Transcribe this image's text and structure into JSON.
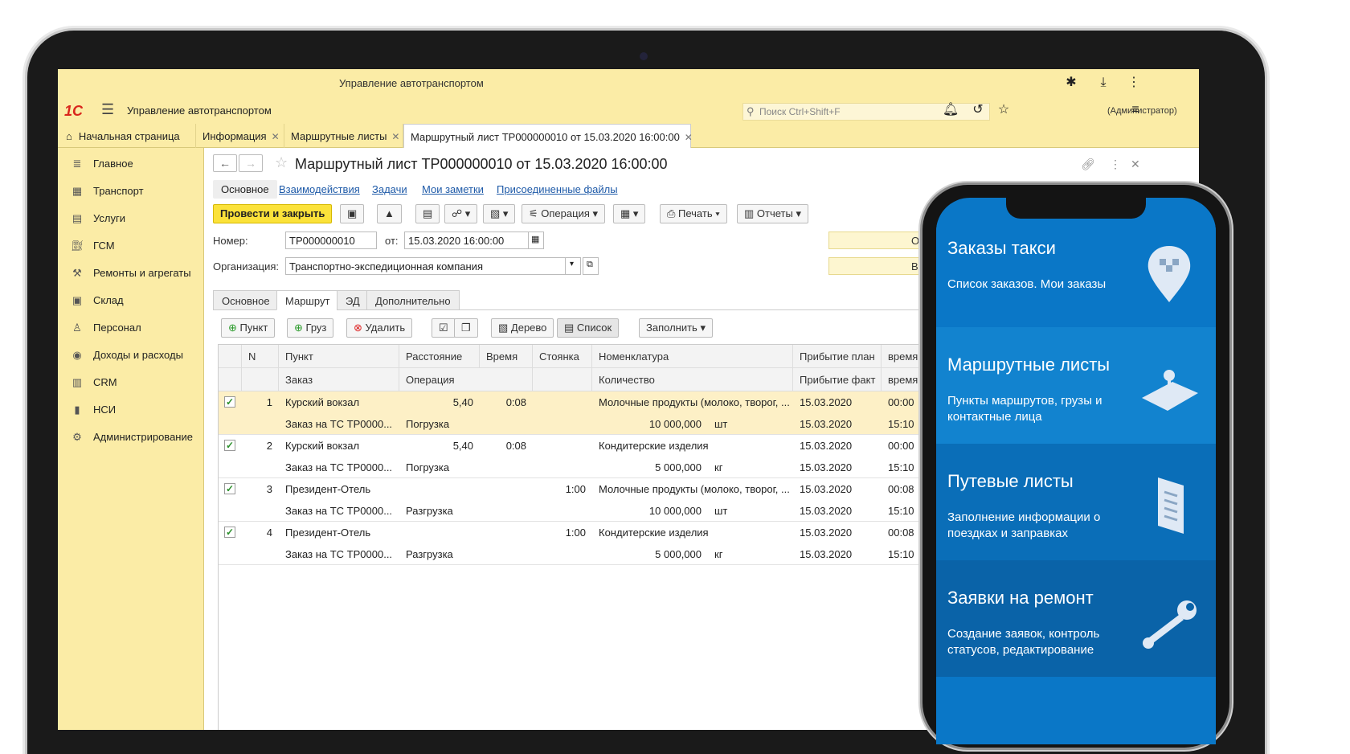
{
  "window": {
    "title": "Управление автотранспортом"
  },
  "appbar": {
    "logo": "1С",
    "app_name": "Управление автотранспортом",
    "search_placeholder": "Поиск Ctrl+Shift+F",
    "user": "(Администратор)"
  },
  "tabs": [
    {
      "label": "Начальная страница"
    },
    {
      "label": "Информация"
    },
    {
      "label": "Маршрутные листы"
    },
    {
      "label": "Маршрутный лист ТР000000010 от 15.03.2020 16:00:00"
    }
  ],
  "sidebar": {
    "items": [
      {
        "label": "Главное",
        "icon": "menu-lines-icon"
      },
      {
        "label": "Транспорт",
        "icon": "truck-icon"
      },
      {
        "label": "Услуги",
        "icon": "clipboard-icon"
      },
      {
        "label": "ГСМ",
        "icon": "fuel-icon"
      },
      {
        "label": "Ремонты и агрегаты",
        "icon": "wrench-icon"
      },
      {
        "label": "Склад",
        "icon": "boxes-icon"
      },
      {
        "label": "Персонал",
        "icon": "person-icon"
      },
      {
        "label": "Доходы и расходы",
        "icon": "coins-icon"
      },
      {
        "label": "CRM",
        "icon": "crm-icon"
      },
      {
        "label": "НСИ",
        "icon": "book-icon"
      },
      {
        "label": "Администрирование",
        "icon": "gear-icon"
      }
    ]
  },
  "document": {
    "title": "Маршрутный лист ТР000000010 от 15.03.2020 16:00:00",
    "link_tabs": [
      "Основное",
      "Взаимодействия",
      "Задачи",
      "Мои заметки",
      "Присоединенные файлы"
    ],
    "toolbar": {
      "post_close": "Провести и закрыть",
      "operation": "Операция",
      "print": "Печать",
      "reports": "Отчеты"
    },
    "fields": {
      "number_label": "Номер:",
      "number_value": "ТР000000010",
      "date_label": "от:",
      "date_value": "15.03.2020 16:00:00",
      "org_label": "Организация:",
      "org_value": "Транспортно-экспедиционная компания",
      "right_top": "От",
      "right_bottom": "Вы"
    },
    "sub_tabs": [
      "Основное",
      "Маршрут",
      "ЭД",
      "Дополнительно"
    ],
    "route_toolbar": {
      "point": "Пункт",
      "cargo": "Груз",
      "delete": "Удалить",
      "tree": "Дерево",
      "list": "Список",
      "fill": "Заполнить"
    }
  },
  "route_table": {
    "headers_top": [
      "N",
      "Пункт",
      "Расстояние",
      "Время",
      "Стоянка",
      "Номенклатура",
      "Прибытие план",
      "время"
    ],
    "headers_bottom": [
      "Заказ",
      "Операция",
      "Количество",
      "Прибытие факт",
      "время"
    ],
    "rows": [
      {
        "n": "1",
        "point": "Курский вокзал",
        "distance": "5,40",
        "time": "0:08",
        "stop": "",
        "item": "Молочные продукты (молоко, творог, ...",
        "plan_date": "15.03.2020",
        "plan_time": "00:00",
        "order": "Заказ на ТС ТР0000...",
        "operation": "Погрузка",
        "qty": "10 000,000",
        "unit": "шт",
        "fact_date": "15.03.2020",
        "fact_time": "15:10",
        "checked": true,
        "selected": true
      },
      {
        "n": "2",
        "point": "Курский вокзал",
        "distance": "5,40",
        "time": "0:08",
        "stop": "",
        "item": "Кондитерские изделия",
        "plan_date": "15.03.2020",
        "plan_time": "00:00",
        "order": "Заказ на ТС ТР0000...",
        "operation": "Погрузка",
        "qty": "5 000,000",
        "unit": "кг",
        "fact_date": "15.03.2020",
        "fact_time": "15:10",
        "checked": true,
        "selected": false
      },
      {
        "n": "3",
        "point": "Президент-Отель",
        "distance": "",
        "time": "",
        "stop": "1:00",
        "item": "Молочные продукты (молоко, творог, ...",
        "plan_date": "15.03.2020",
        "plan_time": "00:08",
        "order": "Заказ на ТС ТР0000...",
        "operation": "Разгрузка",
        "qty": "10 000,000",
        "unit": "шт",
        "fact_date": "15.03.2020",
        "fact_time": "15:10",
        "checked": true,
        "selected": false
      },
      {
        "n": "4",
        "point": "Президент-Отель",
        "distance": "",
        "time": "",
        "stop": "1:00",
        "item": "Кондитерские изделия",
        "plan_date": "15.03.2020",
        "plan_time": "00:08",
        "order": "Заказ на ТС ТР0000...",
        "operation": "Разгрузка",
        "qty": "5 000,000",
        "unit": "кг",
        "fact_date": "15.03.2020",
        "fact_time": "15:10",
        "checked": true,
        "selected": false
      }
    ]
  },
  "phone": {
    "tiles": [
      {
        "title": "Заказы такси",
        "desc": "Список заказов. Мои заказы",
        "color": "#0a77c7",
        "icon": "taxi-pin-icon"
      },
      {
        "title": "Маршрутные листы",
        "desc": "Пункты маршрутов, грузы и контактные лица",
        "color": "#1283cf",
        "icon": "map-pin-icon"
      },
      {
        "title": "Путевые листы",
        "desc": "Заполнение информации о поездках и заправках",
        "color": "#0a6eb8",
        "icon": "document-scroll-icon"
      },
      {
        "title": "Заявки на ремонт",
        "desc": "Создание заявок, контроль статусов, редактирование",
        "color": "#0a63a8",
        "icon": "wrench-icon"
      }
    ]
  },
  "colors": {
    "yellow_panel": "#fbeca6",
    "accent_button": "#fbe23a",
    "link": "#1e5aa8",
    "phone_blue": "#0a77c7"
  }
}
